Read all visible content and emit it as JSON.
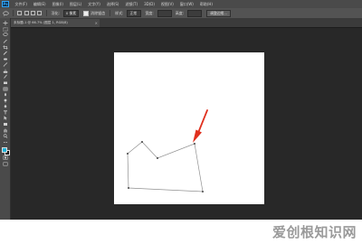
{
  "menubar": {
    "logo": "Ps",
    "items": [
      "文件(F)",
      "编辑(E)",
      "图像(I)",
      "图层(L)",
      "文字(Y)",
      "选择(S)",
      "滤镜(T)",
      "3D(D)",
      "视图(V)",
      "窗口(W)",
      "帮助(H)"
    ]
  },
  "options": {
    "feather_label": "羽化:",
    "feather_value": "0 像素",
    "antialias_label": "消除锯齿",
    "style_label": "样式:",
    "style_value": "正常",
    "width_label": "宽度:",
    "height_label": "高度:",
    "refine_button": "调整边缘..."
  },
  "tab": {
    "title": "未标题-1 @ 66.7% (图层 1, RGB/8)",
    "close": "×"
  },
  "colors": {
    "foreground": "#1db2d8",
    "background": "#111111",
    "arrow": "#e0301e"
  },
  "watermark": "爱创根知识网"
}
